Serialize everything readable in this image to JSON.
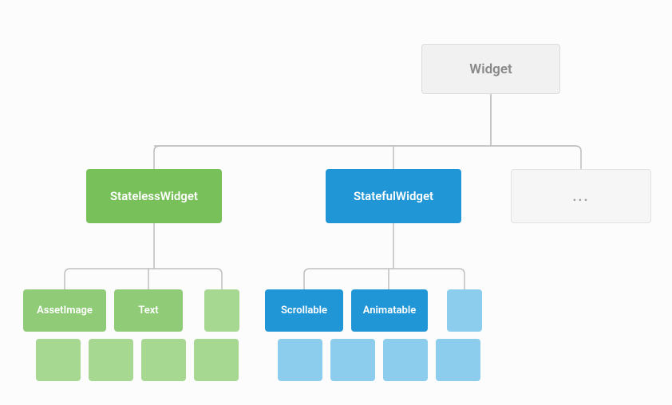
{
  "root": {
    "label": "Widget"
  },
  "branches": {
    "stateless": {
      "label": "StatelessWidget",
      "children": [
        "AssetImage",
        "Text",
        ""
      ]
    },
    "stateful": {
      "label": "StatefulWidget",
      "children": [
        "Scrollable",
        "Animatable",
        ""
      ]
    },
    "more": {
      "label": "..."
    }
  },
  "colors": {
    "rootBg": "#f1f1f1",
    "green": "#78c15a",
    "greenLight": "#a7d891",
    "blue": "#2196d6",
    "blueLight": "#8ccdee",
    "line": "#bfbfbf"
  }
}
